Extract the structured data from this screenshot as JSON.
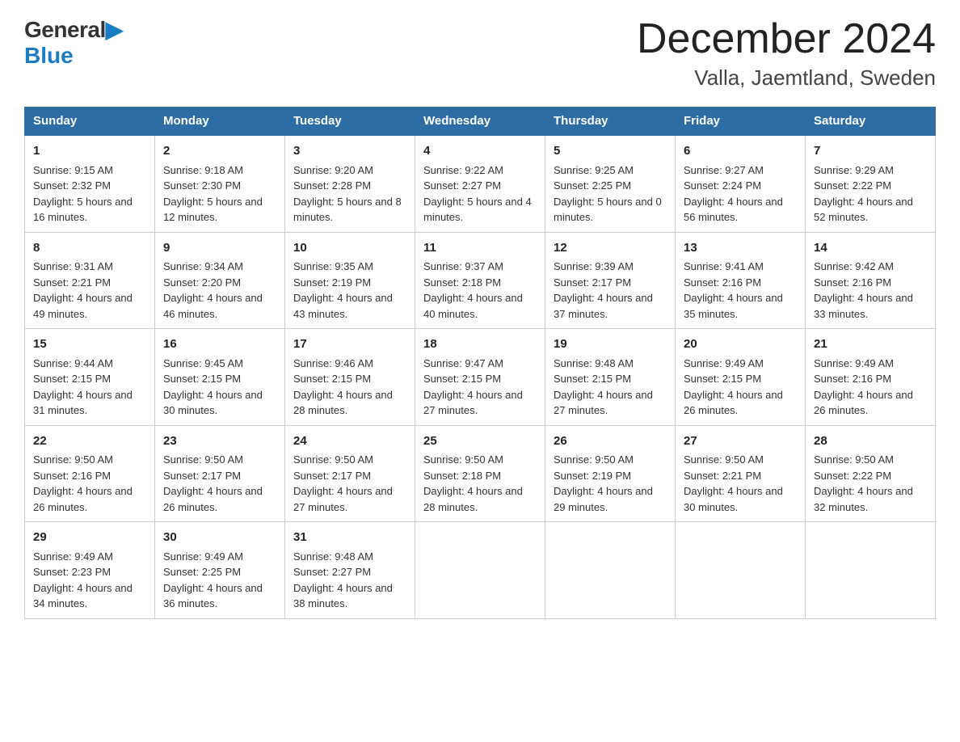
{
  "header": {
    "logo_general": "General",
    "logo_blue": "Blue",
    "month_title": "December 2024",
    "location": "Valla, Jaemtland, Sweden"
  },
  "days_header": [
    "Sunday",
    "Monday",
    "Tuesday",
    "Wednesday",
    "Thursday",
    "Friday",
    "Saturday"
  ],
  "weeks": [
    [
      {
        "num": "1",
        "sunrise": "Sunrise: 9:15 AM",
        "sunset": "Sunset: 2:32 PM",
        "daylight": "Daylight: 5 hours and 16 minutes."
      },
      {
        "num": "2",
        "sunrise": "Sunrise: 9:18 AM",
        "sunset": "Sunset: 2:30 PM",
        "daylight": "Daylight: 5 hours and 12 minutes."
      },
      {
        "num": "3",
        "sunrise": "Sunrise: 9:20 AM",
        "sunset": "Sunset: 2:28 PM",
        "daylight": "Daylight: 5 hours and 8 minutes."
      },
      {
        "num": "4",
        "sunrise": "Sunrise: 9:22 AM",
        "sunset": "Sunset: 2:27 PM",
        "daylight": "Daylight: 5 hours and 4 minutes."
      },
      {
        "num": "5",
        "sunrise": "Sunrise: 9:25 AM",
        "sunset": "Sunset: 2:25 PM",
        "daylight": "Daylight: 5 hours and 0 minutes."
      },
      {
        "num": "6",
        "sunrise": "Sunrise: 9:27 AM",
        "sunset": "Sunset: 2:24 PM",
        "daylight": "Daylight: 4 hours and 56 minutes."
      },
      {
        "num": "7",
        "sunrise": "Sunrise: 9:29 AM",
        "sunset": "Sunset: 2:22 PM",
        "daylight": "Daylight: 4 hours and 52 minutes."
      }
    ],
    [
      {
        "num": "8",
        "sunrise": "Sunrise: 9:31 AM",
        "sunset": "Sunset: 2:21 PM",
        "daylight": "Daylight: 4 hours and 49 minutes."
      },
      {
        "num": "9",
        "sunrise": "Sunrise: 9:34 AM",
        "sunset": "Sunset: 2:20 PM",
        "daylight": "Daylight: 4 hours and 46 minutes."
      },
      {
        "num": "10",
        "sunrise": "Sunrise: 9:35 AM",
        "sunset": "Sunset: 2:19 PM",
        "daylight": "Daylight: 4 hours and 43 minutes."
      },
      {
        "num": "11",
        "sunrise": "Sunrise: 9:37 AM",
        "sunset": "Sunset: 2:18 PM",
        "daylight": "Daylight: 4 hours and 40 minutes."
      },
      {
        "num": "12",
        "sunrise": "Sunrise: 9:39 AM",
        "sunset": "Sunset: 2:17 PM",
        "daylight": "Daylight: 4 hours and 37 minutes."
      },
      {
        "num": "13",
        "sunrise": "Sunrise: 9:41 AM",
        "sunset": "Sunset: 2:16 PM",
        "daylight": "Daylight: 4 hours and 35 minutes."
      },
      {
        "num": "14",
        "sunrise": "Sunrise: 9:42 AM",
        "sunset": "Sunset: 2:16 PM",
        "daylight": "Daylight: 4 hours and 33 minutes."
      }
    ],
    [
      {
        "num": "15",
        "sunrise": "Sunrise: 9:44 AM",
        "sunset": "Sunset: 2:15 PM",
        "daylight": "Daylight: 4 hours and 31 minutes."
      },
      {
        "num": "16",
        "sunrise": "Sunrise: 9:45 AM",
        "sunset": "Sunset: 2:15 PM",
        "daylight": "Daylight: 4 hours and 30 minutes."
      },
      {
        "num": "17",
        "sunrise": "Sunrise: 9:46 AM",
        "sunset": "Sunset: 2:15 PM",
        "daylight": "Daylight: 4 hours and 28 minutes."
      },
      {
        "num": "18",
        "sunrise": "Sunrise: 9:47 AM",
        "sunset": "Sunset: 2:15 PM",
        "daylight": "Daylight: 4 hours and 27 minutes."
      },
      {
        "num": "19",
        "sunrise": "Sunrise: 9:48 AM",
        "sunset": "Sunset: 2:15 PM",
        "daylight": "Daylight: 4 hours and 27 minutes."
      },
      {
        "num": "20",
        "sunrise": "Sunrise: 9:49 AM",
        "sunset": "Sunset: 2:15 PM",
        "daylight": "Daylight: 4 hours and 26 minutes."
      },
      {
        "num": "21",
        "sunrise": "Sunrise: 9:49 AM",
        "sunset": "Sunset: 2:16 PM",
        "daylight": "Daylight: 4 hours and 26 minutes."
      }
    ],
    [
      {
        "num": "22",
        "sunrise": "Sunrise: 9:50 AM",
        "sunset": "Sunset: 2:16 PM",
        "daylight": "Daylight: 4 hours and 26 minutes."
      },
      {
        "num": "23",
        "sunrise": "Sunrise: 9:50 AM",
        "sunset": "Sunset: 2:17 PM",
        "daylight": "Daylight: 4 hours and 26 minutes."
      },
      {
        "num": "24",
        "sunrise": "Sunrise: 9:50 AM",
        "sunset": "Sunset: 2:17 PM",
        "daylight": "Daylight: 4 hours and 27 minutes."
      },
      {
        "num": "25",
        "sunrise": "Sunrise: 9:50 AM",
        "sunset": "Sunset: 2:18 PM",
        "daylight": "Daylight: 4 hours and 28 minutes."
      },
      {
        "num": "26",
        "sunrise": "Sunrise: 9:50 AM",
        "sunset": "Sunset: 2:19 PM",
        "daylight": "Daylight: 4 hours and 29 minutes."
      },
      {
        "num": "27",
        "sunrise": "Sunrise: 9:50 AM",
        "sunset": "Sunset: 2:21 PM",
        "daylight": "Daylight: 4 hours and 30 minutes."
      },
      {
        "num": "28",
        "sunrise": "Sunrise: 9:50 AM",
        "sunset": "Sunset: 2:22 PM",
        "daylight": "Daylight: 4 hours and 32 minutes."
      }
    ],
    [
      {
        "num": "29",
        "sunrise": "Sunrise: 9:49 AM",
        "sunset": "Sunset: 2:23 PM",
        "daylight": "Daylight: 4 hours and 34 minutes."
      },
      {
        "num": "30",
        "sunrise": "Sunrise: 9:49 AM",
        "sunset": "Sunset: 2:25 PM",
        "daylight": "Daylight: 4 hours and 36 minutes."
      },
      {
        "num": "31",
        "sunrise": "Sunrise: 9:48 AM",
        "sunset": "Sunset: 2:27 PM",
        "daylight": "Daylight: 4 hours and 38 minutes."
      },
      null,
      null,
      null,
      null
    ]
  ]
}
